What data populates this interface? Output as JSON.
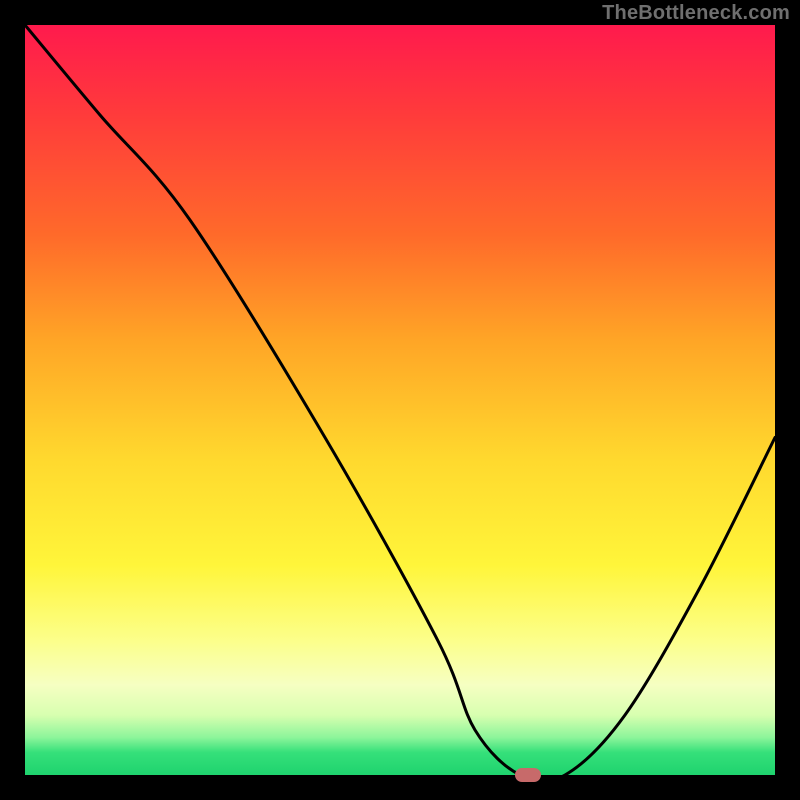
{
  "watermark": "TheBottleneck.com",
  "chart_data": {
    "type": "line",
    "title": "",
    "xlabel": "",
    "ylabel": "",
    "xlim": [
      0,
      100
    ],
    "ylim": [
      0,
      100
    ],
    "series": [
      {
        "name": "bottleneck-curve",
        "x": [
          0,
          10,
          22,
          40,
          55,
          60,
          66,
          72,
          80,
          90,
          100
        ],
        "y": [
          100,
          88,
          74,
          45,
          18,
          6,
          0,
          0,
          8,
          25,
          45
        ]
      }
    ],
    "marker": {
      "x": 67,
      "y": 0,
      "color": "#c76a6a"
    },
    "gradient_stops": [
      {
        "pos": 0,
        "color": "#ff1a4d"
      },
      {
        "pos": 12,
        "color": "#ff3b3b"
      },
      {
        "pos": 28,
        "color": "#ff6a2a"
      },
      {
        "pos": 42,
        "color": "#ffa526"
      },
      {
        "pos": 58,
        "color": "#ffd92e"
      },
      {
        "pos": 72,
        "color": "#fff53a"
      },
      {
        "pos": 82,
        "color": "#fcff8a"
      },
      {
        "pos": 88,
        "color": "#f6ffc2"
      },
      {
        "pos": 92,
        "color": "#d8ffb0"
      },
      {
        "pos": 95,
        "color": "#8cf59a"
      },
      {
        "pos": 97,
        "color": "#35e07a"
      },
      {
        "pos": 100,
        "color": "#1fd36e"
      }
    ]
  }
}
